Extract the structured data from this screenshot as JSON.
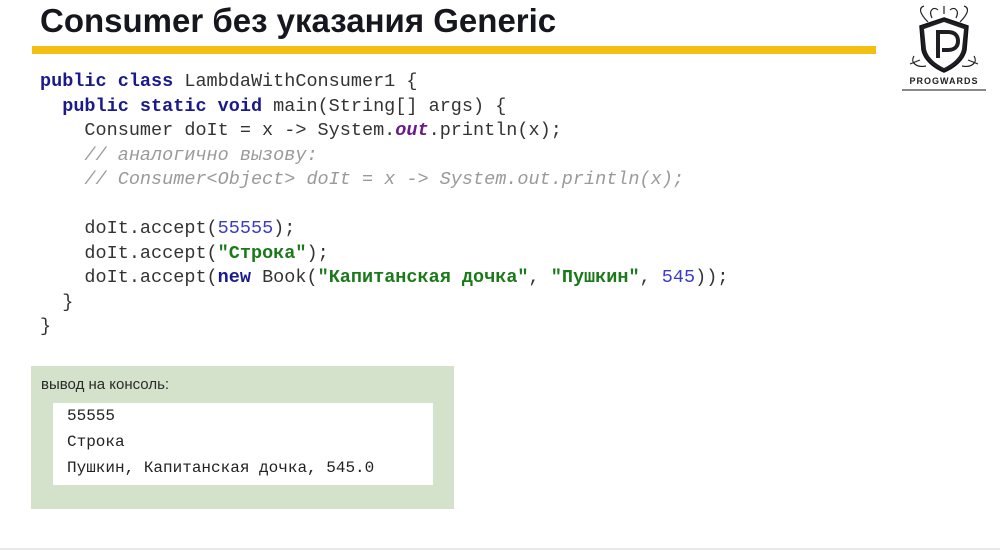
{
  "slide": {
    "title": "Consumer без указания Generic"
  },
  "logo": {
    "text": "PROGWARDS",
    "icon": "progwards-shield-logo"
  },
  "code": {
    "l1": {
      "kw": "public class",
      "rest": " LambdaWithConsumer1 {"
    },
    "l2": {
      "kw": "public static void",
      "rest": " main(String[] args) {"
    },
    "l3": {
      "pre": "Consumer doIt = x -> System.",
      "field": "out",
      "post": ".println(x);"
    },
    "l4": "// аналогично вызову:",
    "l5": "// Consumer<Object> doIt = x -> System.out.println(x);",
    "l7": {
      "pre": "doIt.accept(",
      "num": "55555",
      "post": ");"
    },
    "l8": {
      "pre": "doIt.accept(",
      "str": "\"Строка\"",
      "post": ");"
    },
    "l9": {
      "pre": "doIt.accept(",
      "kw": "new",
      "mid": " Book(",
      "str1": "\"Капитанская дочка\"",
      "sep": ", ",
      "str2": "\"Пушкин\"",
      "sep2": ", ",
      "num": "545",
      "post": "));"
    },
    "l10": "}",
    "l11": "}"
  },
  "console": {
    "label": "вывод на консоль:",
    "lines": [
      "55555",
      "Строка",
      "Пушкин, Капитанская дочка, 545.0"
    ]
  },
  "colors": {
    "accent_bar": "#f3bf12",
    "console_bg": "#d4e2cb",
    "keyword": "#1a1a8c",
    "string": "#1a7a1a",
    "number": "#3b3bc6"
  }
}
